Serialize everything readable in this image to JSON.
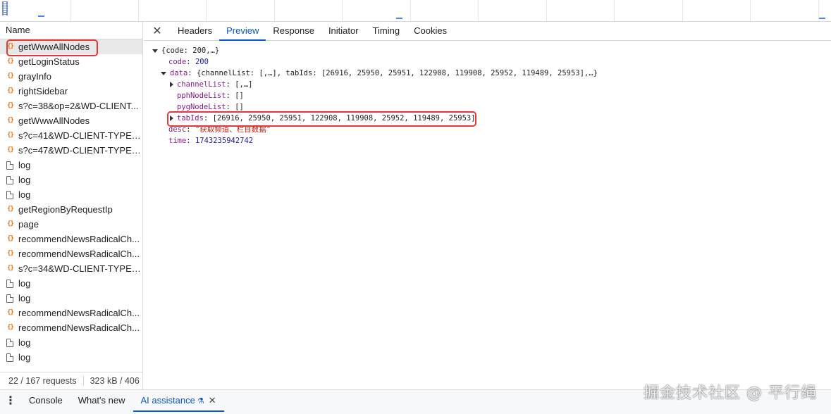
{
  "requests": {
    "header": "Name",
    "items": [
      {
        "name": "getWwwAllNodes",
        "type": "json"
      },
      {
        "name": "getLoginStatus",
        "type": "json"
      },
      {
        "name": "grayInfo",
        "type": "json"
      },
      {
        "name": "rightSidebar",
        "type": "json"
      },
      {
        "name": "s?c=38&op=2&WD-CLIENT...",
        "type": "json"
      },
      {
        "name": "getWwwAllNodes",
        "type": "json"
      },
      {
        "name": "s?c=41&WD-CLIENT-TYPE=...",
        "type": "json"
      },
      {
        "name": "s?c=47&WD-CLIENT-TYPE=...",
        "type": "json"
      },
      {
        "name": "log",
        "type": "doc"
      },
      {
        "name": "log",
        "type": "doc"
      },
      {
        "name": "log",
        "type": "doc"
      },
      {
        "name": "getRegionByRequestIp",
        "type": "json"
      },
      {
        "name": "page",
        "type": "json"
      },
      {
        "name": "recommendNewsRadicalCh...",
        "type": "json"
      },
      {
        "name": "recommendNewsRadicalCh...",
        "type": "json"
      },
      {
        "name": "s?c=34&WD-CLIENT-TYPE=...",
        "type": "json"
      },
      {
        "name": "log",
        "type": "doc"
      },
      {
        "name": "log",
        "type": "doc"
      },
      {
        "name": "recommendNewsRadicalCh...",
        "type": "json"
      },
      {
        "name": "recommendNewsRadicalCh...",
        "type": "json"
      },
      {
        "name": "log",
        "type": "doc"
      },
      {
        "name": "log",
        "type": "doc"
      }
    ],
    "footer_requests": "22 / 167 requests",
    "footer_size": "323 kB / 406"
  },
  "detail": {
    "close_icon": "close-icon",
    "tabs": [
      "Headers",
      "Preview",
      "Response",
      "Initiator",
      "Timing",
      "Cookies"
    ],
    "active_tab": "Preview"
  },
  "preview": {
    "root": "{code: 200,…}",
    "code_key": "code",
    "code_val": "200",
    "data_key": "data",
    "data_summary": "{channelList: [,…], tabIds: [26916, 25950, 25951, 122908, 119908, 25952, 119489, 25953],…}",
    "channelList_key": "channelList",
    "channelList_val": "[,…]",
    "pphNodeList_key": "pphNodeList",
    "pphNodeList_val": "[]",
    "pygNodeList_key": "pygNodeList",
    "pygNodeList_val": "[]",
    "tabIds_key": "tabIds",
    "tabIds_val": "[26916, 25950, 25951, 122908, 119908, 25952, 119489, 25953]",
    "desc_key": "desc",
    "desc_val": "\"获取频道、栏目数据\"",
    "time_key": "time",
    "time_val": "1743235942742"
  },
  "drawer": {
    "menu_icon": "kebab-menu-icon",
    "tabs": [
      "Console",
      "What's new",
      "AI assistance"
    ],
    "active_tab": "AI assistance",
    "close": "✕"
  },
  "watermark": "掘金技术社区 @ 平行绳",
  "colors": {
    "accent": "#0b57d0",
    "highlight": "#e03a3a",
    "json_icon": "#e8710a",
    "key": "#8b1c8a",
    "number": "#1a1aa6",
    "string": "#c41a16"
  }
}
